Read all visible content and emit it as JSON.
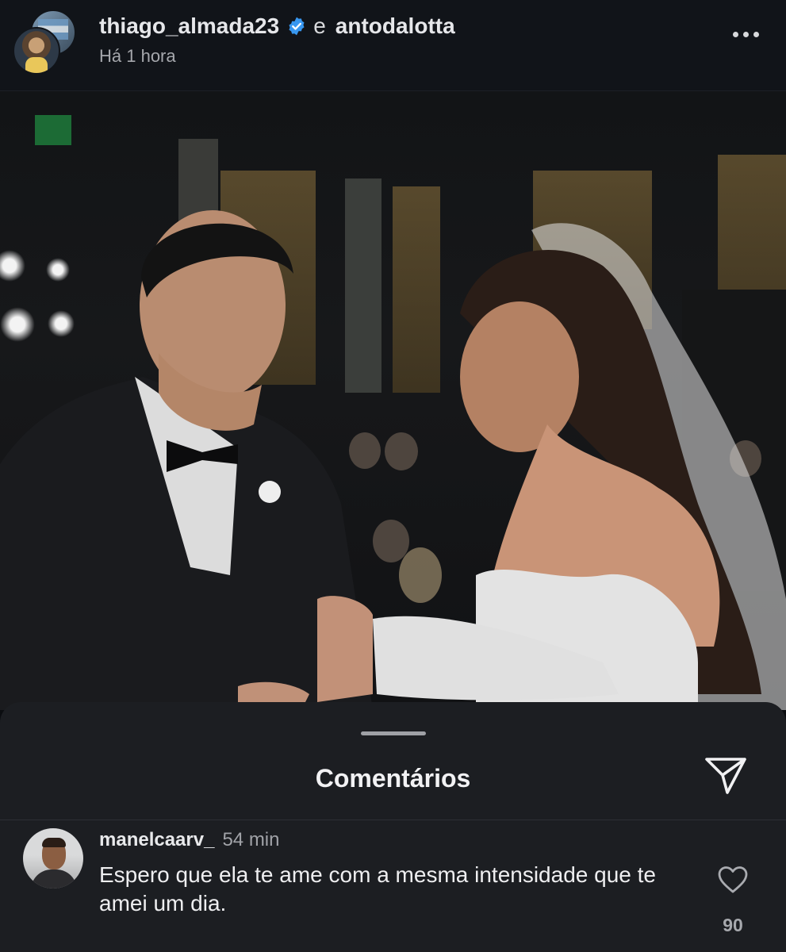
{
  "header": {
    "username": "thiago_almada23",
    "conjunction": "e",
    "collaborator": "antodalotta",
    "time": "Há 1 hora",
    "verified": true,
    "more_icon": "more-horizontal-icon"
  },
  "comments_sheet": {
    "title": "Comentários",
    "share_icon": "send-icon",
    "comments": [
      {
        "username": "manelcaarv_",
        "time": "54 min",
        "text": "Espero que ela te ame com a mesma intensidade que te amei um dia.",
        "likes": "90"
      }
    ]
  },
  "colors": {
    "background": "#0b0d10",
    "sheet": "#1c1e22",
    "verified_badge": "#3897f0"
  }
}
